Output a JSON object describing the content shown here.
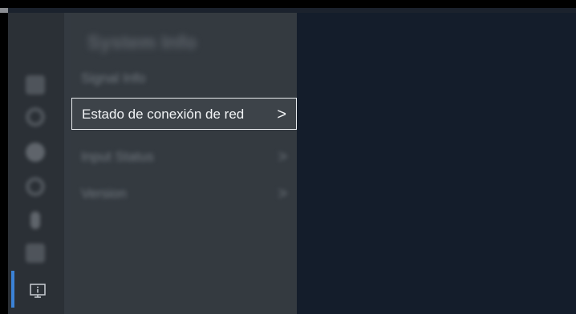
{
  "menu": {
    "title": "System Info",
    "items": [
      {
        "label": "Signal Info",
        "selected": false
      },
      {
        "label": "Estado de conexión de red",
        "selected": true,
        "chevron": ">"
      },
      {
        "label": "Input Status",
        "selected": false,
        "chevron": ">"
      },
      {
        "label": "Version",
        "selected": false,
        "chevron": ">"
      }
    ]
  },
  "rail": {
    "icons": [
      "picture-icon",
      "sound-icon",
      "network-icon",
      "general-icon",
      "support-icon",
      "apps-icon",
      "info-icon"
    ],
    "active": "info-icon"
  },
  "colors": {
    "accent": "#3b82d6",
    "panel": "#343a40",
    "content": "#141d2b"
  }
}
